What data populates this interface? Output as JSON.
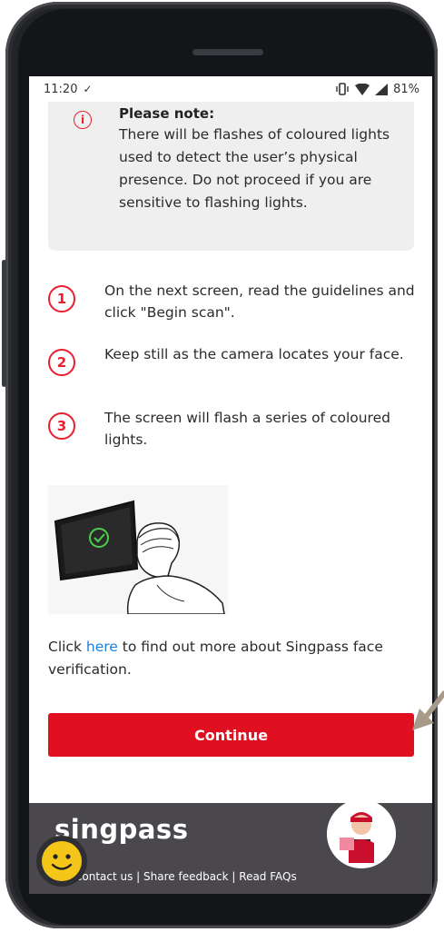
{
  "status_bar": {
    "time": "11:20",
    "download_glyph": "✓",
    "battery": "81%",
    "icons": [
      "vibrate-icon",
      "wifi-icon",
      "signal-icon"
    ]
  },
  "notice": {
    "title": "Please note:",
    "text": "There will be flashes of coloured lights used to detect the user’s physical presence. Do not proceed if you are sensitive to flashing lights.",
    "icon": "info-icon"
  },
  "steps": [
    {
      "num": "1",
      "text": "On the next screen, read the guidelines and click \"Begin scan\"."
    },
    {
      "num": "2",
      "text": "Keep still as the camera locates your face."
    },
    {
      "num": "3",
      "text": "The screen will flash a series of coloured lights."
    }
  ],
  "more_info": {
    "prefix": "Click ",
    "link_text": "here",
    "suffix": " to find out more about Singpass face verification."
  },
  "continue_label": "Continue",
  "footer": {
    "logo": "singpass",
    "links": "Contact us | Share feedback | Read FAQs"
  },
  "colors": {
    "accent": "#e01020",
    "link": "#1f7ed6",
    "footer_bg": "#4a474d",
    "notice_bg": "#efefef"
  }
}
